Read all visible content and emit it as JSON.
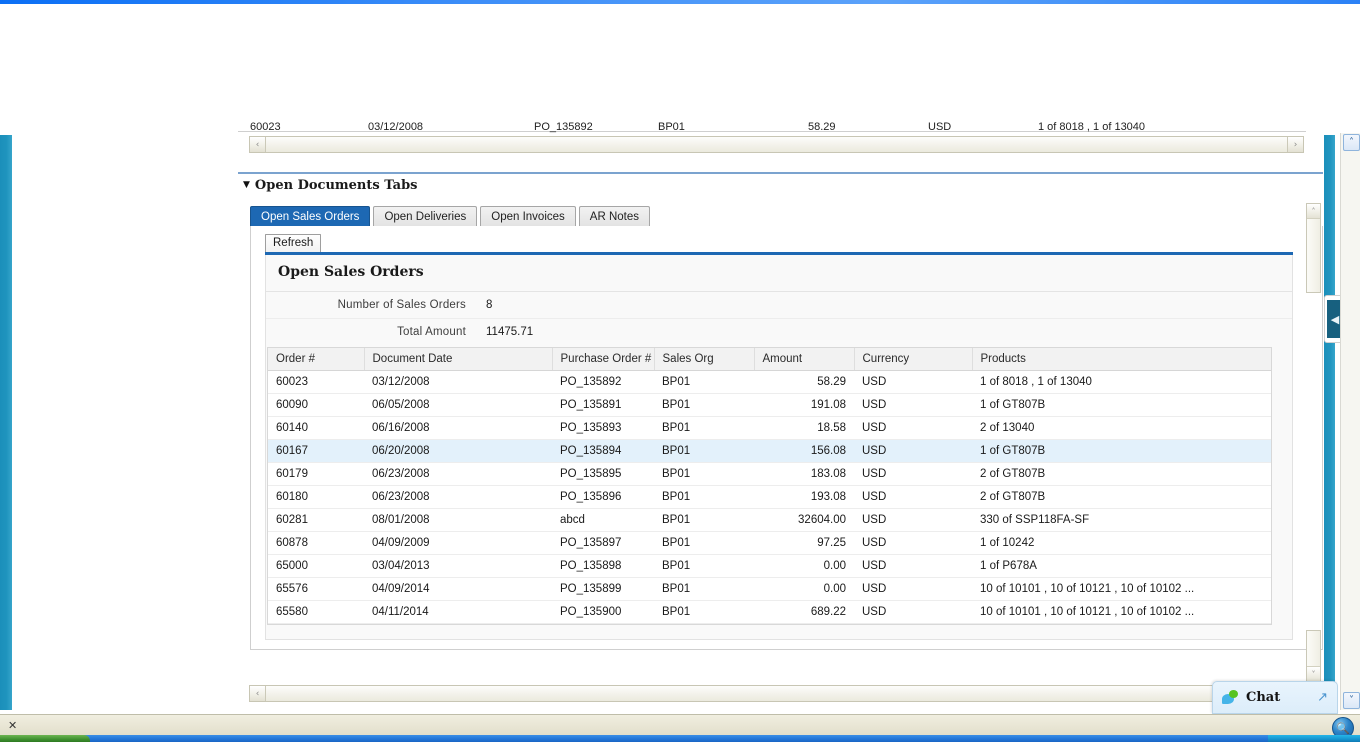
{
  "window": {
    "statusbar_close_label": "✕",
    "zoom_icon": "search-orb-icon"
  },
  "section": {
    "caret": "▼",
    "title": "Open Documents Tabs"
  },
  "tabs": [
    {
      "label": "Open Sales Orders",
      "active": true
    },
    {
      "label": "Open Deliveries",
      "active": false
    },
    {
      "label": "Open Invoices",
      "active": false
    },
    {
      "label": "AR Notes",
      "active": false
    }
  ],
  "toolbar": {
    "refresh_label": "Refresh"
  },
  "panel": {
    "title": "Open Sales Orders",
    "summary": [
      {
        "key": "Number of Sales Orders",
        "value": "8"
      },
      {
        "key": "Total Amount",
        "value": "11475.71"
      }
    ]
  },
  "table": {
    "columns": [
      "Order #",
      "Document Date",
      "Purchase Order #",
      "Sales Org",
      "Amount",
      "Currency",
      "Products"
    ],
    "rows": [
      {
        "order": "60023",
        "date": "03/12/2008",
        "po": "PO_135892",
        "org": "BP01",
        "amount": "58.29",
        "currency": "USD",
        "products": "1 of 8018 , 1 of 13040",
        "selected": false
      },
      {
        "order": "60090",
        "date": "06/05/2008",
        "po": "PO_135891",
        "org": "BP01",
        "amount": "191.08",
        "currency": "USD",
        "products": "1 of GT807B",
        "selected": false
      },
      {
        "order": "60140",
        "date": "06/16/2008",
        "po": "PO_135893",
        "org": "BP01",
        "amount": "18.58",
        "currency": "USD",
        "products": "2 of 13040",
        "selected": false
      },
      {
        "order": "60167",
        "date": "06/20/2008",
        "po": "PO_135894",
        "org": "BP01",
        "amount": "156.08",
        "currency": "USD",
        "products": "1 of GT807B",
        "selected": true
      },
      {
        "order": "60179",
        "date": "06/23/2008",
        "po": "PO_135895",
        "org": "BP01",
        "amount": "183.08",
        "currency": "USD",
        "products": "2 of GT807B",
        "selected": false
      },
      {
        "order": "60180",
        "date": "06/23/2008",
        "po": "PO_135896",
        "org": "BP01",
        "amount": "193.08",
        "currency": "USD",
        "products": "2 of GT807B",
        "selected": false
      },
      {
        "order": "60281",
        "date": "08/01/2008",
        "po": "abcd",
        "org": "BP01",
        "amount": "32604.00",
        "currency": "USD",
        "products": "330 of SSP118FA-SF",
        "selected": false
      },
      {
        "order": "60878",
        "date": "04/09/2009",
        "po": "PO_135897",
        "org": "BP01",
        "amount": "97.25",
        "currency": "USD",
        "products": "1 of 10242",
        "selected": false
      },
      {
        "order": "65000",
        "date": "03/04/2013",
        "po": "PO_135898",
        "org": "BP01",
        "amount": "0.00",
        "currency": "USD",
        "products": "1 of P678A",
        "selected": false
      },
      {
        "order": "65576",
        "date": "04/09/2014",
        "po": "PO_135899",
        "org": "BP01",
        "amount": "0.00",
        "currency": "USD",
        "products": "10 of 10101 , 10 of 10121 , 10 of 10102 ...",
        "selected": false
      },
      {
        "order": "65580",
        "date": "04/11/2014",
        "po": "PO_135900",
        "org": "BP01",
        "amount": "689.22",
        "currency": "USD",
        "products": "10 of 10101 , 10 of 10121 , 10 of 10102 ...",
        "selected": false
      }
    ]
  },
  "scrollbars": {
    "left_arrow": "‹",
    "right_arrow": "›",
    "up_arrow": "˄",
    "down_arrow": "˅"
  },
  "flyout": {
    "handle_icon": "◀"
  },
  "chat": {
    "label": "Chat",
    "expand_icon": "↗"
  }
}
